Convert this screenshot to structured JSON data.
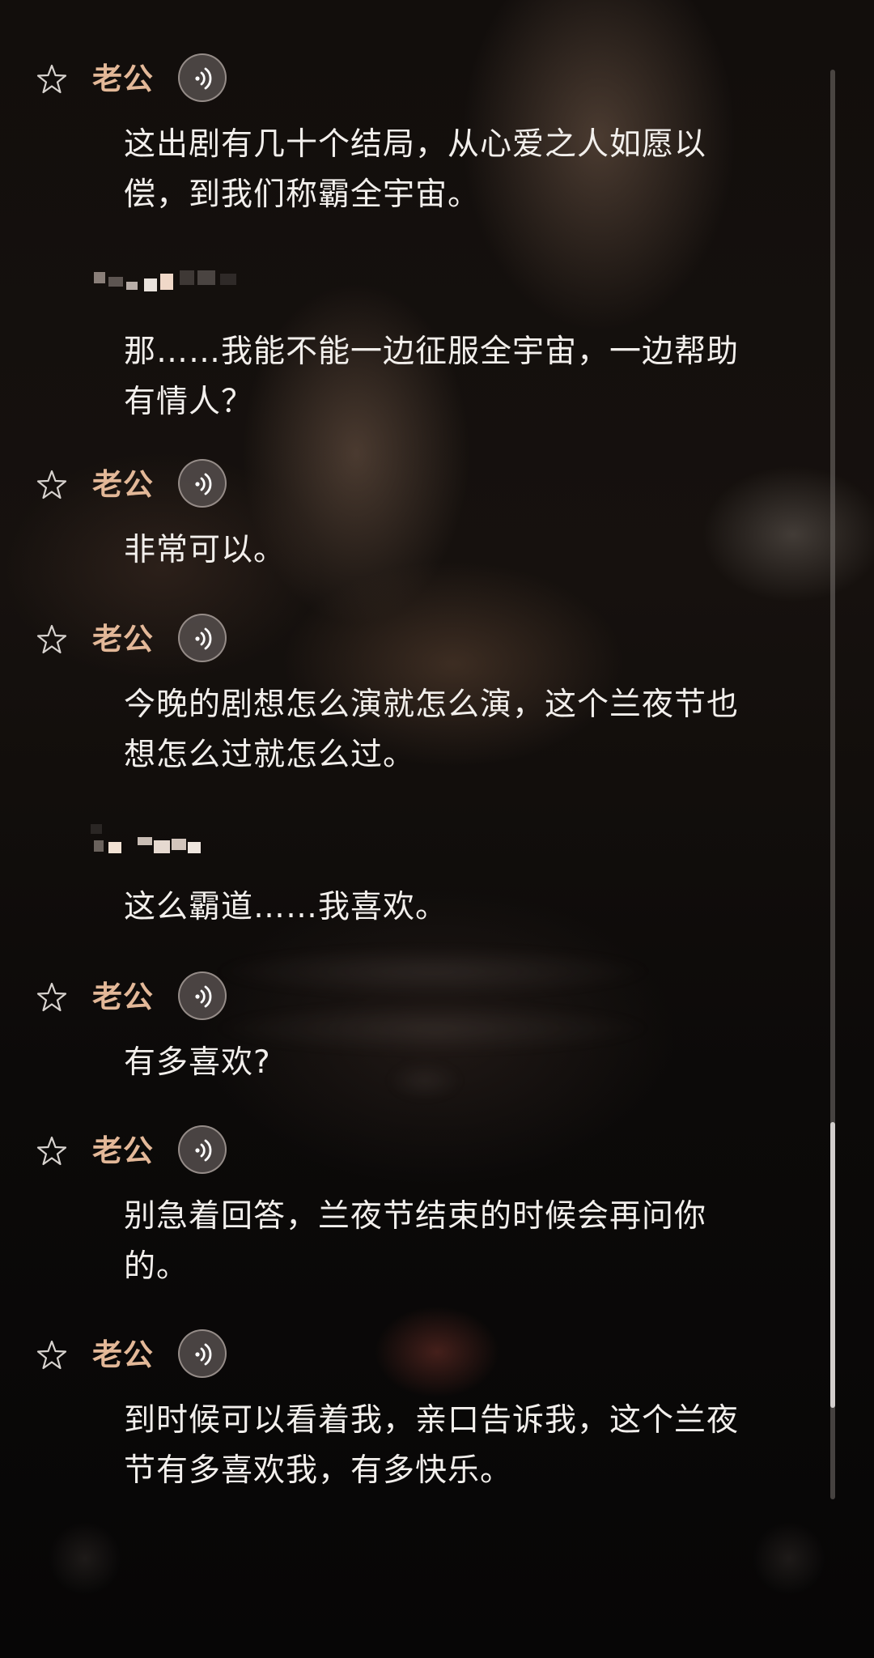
{
  "speaker_name": "老公",
  "messages": [
    {
      "from": "speaker",
      "text": "这出剧有几十个结局，从心爱之人如愿以偿，到我们称霸全宇宙。"
    },
    {
      "from": "user",
      "text": "那……我能不能一边征服全宇宙，一边帮助有情人？"
    },
    {
      "from": "speaker",
      "text": "非常可以。"
    },
    {
      "from": "speaker",
      "text": "今晚的剧想怎么演就怎么演，这个兰夜节也想怎么过就怎么过。"
    },
    {
      "from": "user",
      "text": "这么霸道……我喜欢。"
    },
    {
      "from": "speaker",
      "text": "有多喜欢?"
    },
    {
      "from": "speaker",
      "text": "别急着回答，兰夜节结束的时候会再问你的。"
    },
    {
      "from": "speaker",
      "text": "到时候可以看着我，亲口告诉我，这个兰夜节有多喜欢我，有多快乐。"
    }
  ],
  "icons": {
    "favorite": "star-outline-icon",
    "audio": "audio-play-icon"
  },
  "colors": {
    "speaker_name": "#e3b898",
    "message_text": "#f2efec",
    "background": "#0b0908"
  },
  "scroll_position": 0.92
}
